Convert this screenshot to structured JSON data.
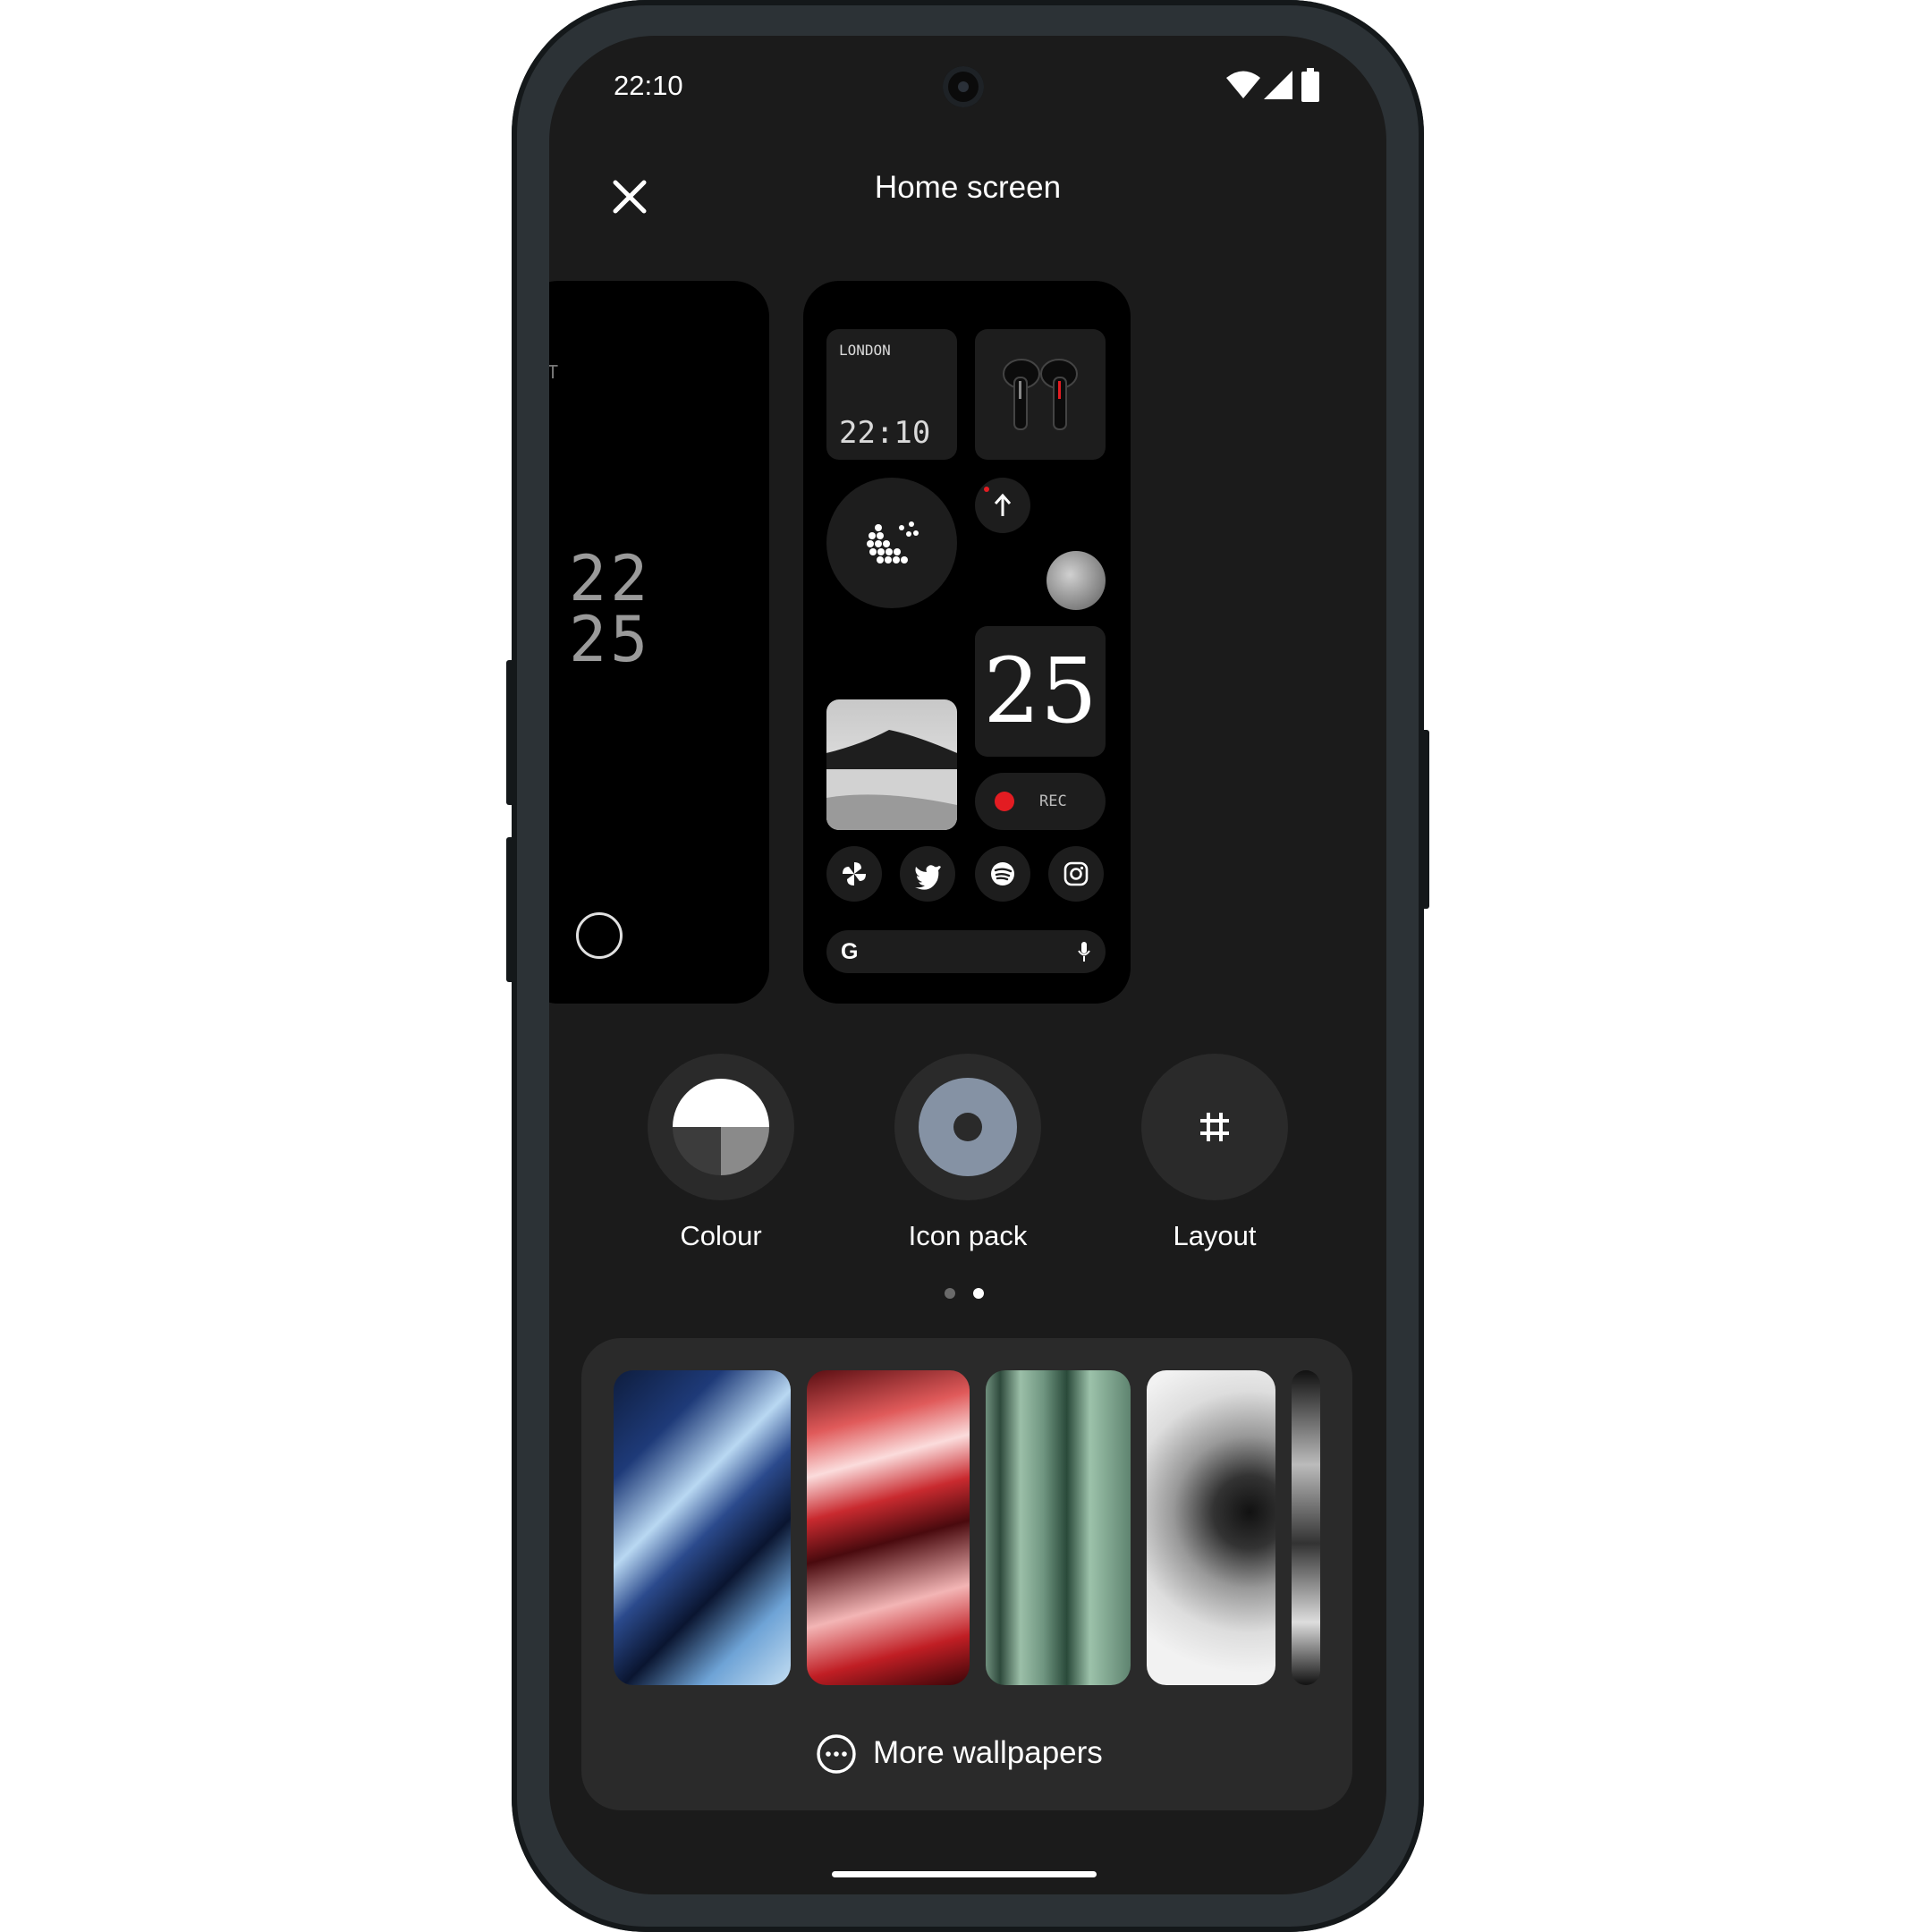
{
  "status_bar": {
    "time": "22:10"
  },
  "header": {
    "title": "Home screen"
  },
  "preview": {
    "left_card_fragment": "T",
    "left_clock_hours": "22",
    "left_clock_minutes": "25",
    "clock_widget": {
      "city": "LONDON",
      "time": "22:10"
    },
    "date_widget": {
      "day": "25"
    },
    "recorder_widget": {
      "label": "REC"
    },
    "search_widget": {
      "g_letter": "G"
    }
  },
  "options": [
    {
      "label": "Colour",
      "icon": "colour-palette-icon"
    },
    {
      "label": "Icon pack",
      "icon": "icon-pack-icon"
    },
    {
      "label": "Layout",
      "icon": "grid-hash-icon"
    }
  ],
  "pager": {
    "pages": 2,
    "active": 2
  },
  "wallpapers": {
    "more_label": "More wallpapers",
    "items": [
      "wallpaper-blue",
      "wallpaper-red",
      "wallpaper-green",
      "wallpaper-grey",
      "wallpaper-dark"
    ]
  },
  "colors": {
    "background": "#1b1b1b",
    "card": "#2a2a2a",
    "rec_dot": "#e31c22",
    "icon_pack": "#8592a4"
  }
}
